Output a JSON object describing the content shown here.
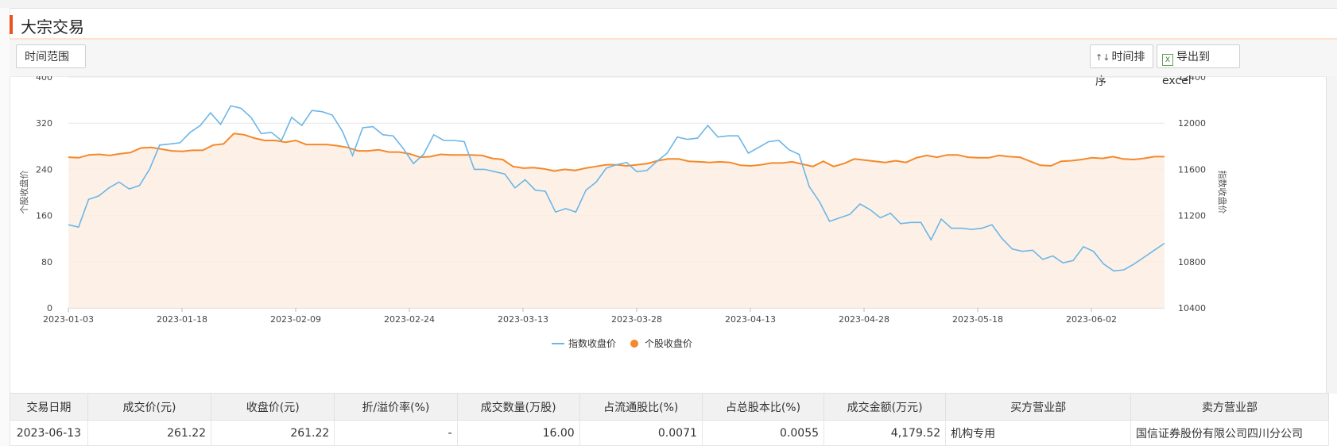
{
  "section": {
    "title": "大宗交易"
  },
  "toolbar": {
    "range_label": "时间范围",
    "sort_label": "时间排序",
    "sort_icon": "sort-arrows-icon",
    "export_label": "导出到excel",
    "export_icon": "excel-icon"
  },
  "colors": {
    "accent": "#e8541d",
    "index_line": "#6cb6e6",
    "stock_line": "#f5882a",
    "stock_fill": "#fdeee3"
  },
  "chart_data": {
    "type": "line",
    "x_ticks": [
      "2023-01-03",
      "2023-01-18",
      "2023-02-09",
      "2023-02-24",
      "2023-03-13",
      "2023-03-28",
      "2023-04-13",
      "2023-04-28",
      "2023-05-18",
      "2023-06-02"
    ],
    "y_left": {
      "label": "个股收盘价",
      "ticks": [
        0,
        80,
        160,
        240,
        320,
        400
      ],
      "range": [
        0,
        400
      ]
    },
    "y_right": {
      "label": "指数收盘价",
      "ticks": [
        10400,
        10800,
        11200,
        11600,
        12000,
        12400
      ],
      "range": [
        10400,
        12400
      ]
    },
    "series": [
      {
        "name": "指数收盘价",
        "axis": "right",
        "style": "line",
        "values": [
          11120,
          11100,
          11340,
          11370,
          11440,
          11490,
          11430,
          11460,
          11600,
          11810,
          11820,
          11830,
          11920,
          11980,
          12090,
          11990,
          12150,
          12130,
          12050,
          11910,
          11920,
          11850,
          12050,
          11980,
          12110,
          12100,
          12070,
          11930,
          11720,
          11960,
          11970,
          11900,
          11890,
          11780,
          11650,
          11730,
          11900,
          11850,
          11850,
          11840,
          11600,
          11600,
          11580,
          11560,
          11440,
          11510,
          11420,
          11410,
          11230,
          11260,
          11230,
          11420,
          11490,
          11610,
          11640,
          11660,
          11580,
          11590,
          11670,
          11740,
          11880,
          11860,
          11870,
          11980,
          11880,
          11890,
          11890,
          11740,
          11790,
          11840,
          11850,
          11770,
          11730,
          11450,
          11320,
          11150,
          11180,
          11210,
          11300,
          11250,
          11180,
          11220,
          11130,
          11140,
          11140,
          10990,
          11170,
          11090,
          11090,
          11080,
          11090,
          11120,
          11000,
          10910,
          10890,
          10900,
          10820,
          10850,
          10790,
          10810,
          10930,
          10890,
          10780,
          10720,
          10730,
          10780,
          10840,
          10900,
          10960
        ]
      },
      {
        "name": "个股收盘价",
        "axis": "left",
        "style": "area",
        "values": [
          261,
          260,
          265,
          266,
          264,
          267,
          269,
          277,
          278,
          275,
          272,
          271,
          273,
          273,
          282,
          284,
          302,
          300,
          294,
          290,
          290,
          287,
          290,
          283,
          283,
          283,
          281,
          278,
          272,
          272,
          274,
          270,
          270,
          267,
          261,
          262,
          266,
          265,
          265,
          265,
          264,
          259,
          257,
          245,
          242,
          243,
          241,
          237,
          240,
          238,
          242,
          245,
          248,
          248,
          246,
          248,
          250,
          255,
          258,
          258,
          254,
          253,
          252,
          253,
          252,
          247,
          246,
          248,
          251,
          251,
          253,
          249,
          245,
          254,
          245,
          250,
          258,
          256,
          254,
          252,
          255,
          252,
          260,
          264,
          261,
          265,
          265,
          261,
          260,
          260,
          264,
          262,
          261,
          254,
          247,
          246,
          254,
          255,
          257,
          260,
          259,
          262,
          258,
          257,
          259,
          262,
          262
        ]
      }
    ],
    "legend": {
      "position": "bottom-center"
    },
    "grid": true
  },
  "table": {
    "headers": [
      "交易日期",
      "成交价(元)",
      "收盘价(元)",
      "折/溢价率(%)",
      "成交数量(万股)",
      "占流通股比(%)",
      "占总股本比(%)",
      "成交金额(万元)",
      "买方营业部",
      "卖方营业部"
    ],
    "rows": [
      [
        "2023-06-13",
        "261.22",
        "261.22",
        "-",
        "16.00",
        "0.0071",
        "0.0055",
        "4,179.52",
        "机构专用",
        "国信证券股份有限公司四川分公司"
      ]
    ]
  }
}
